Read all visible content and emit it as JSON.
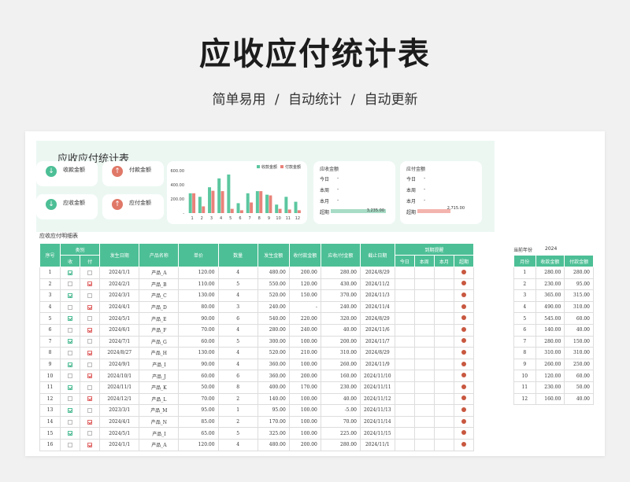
{
  "hero": {
    "title": "应收应付统计表",
    "subtitle": "简单易用  /  自动统计  /  自动更新"
  },
  "dashboard": {
    "title": "应收应付统计表",
    "kpis": [
      {
        "label": "收款金额",
        "icon": "down-arrow-icon",
        "color": "#4dbf96"
      },
      {
        "label": "付款金额",
        "icon": "up-arrow-icon",
        "color": "#e07868"
      },
      {
        "label": "应收金额",
        "icon": "down-arrow-icon",
        "color": "#4dbf96"
      },
      {
        "label": "应付金额",
        "icon": "up-arrow-icon",
        "color": "#e07868"
      }
    ],
    "summaries": [
      {
        "title": "应收金额",
        "rows": [
          {
            "label": "今日",
            "value": "-"
          },
          {
            "label": "本周",
            "value": "-"
          },
          {
            "label": "本月",
            "value": "-"
          },
          {
            "label": "超期",
            "value": "3,235.00"
          }
        ],
        "bar_color": "#a8dcc6",
        "bar_fill": 1.0
      },
      {
        "title": "应付金额",
        "rows": [
          {
            "label": "今日",
            "value": "-"
          },
          {
            "label": "本周",
            "value": "-"
          },
          {
            "label": "本月",
            "value": "-"
          },
          {
            "label": "超期",
            "value": "2,715.00"
          }
        ],
        "bar_color": "#f4b4ae",
        "bar_fill": 0.6
      }
    ]
  },
  "chart_data": {
    "type": "bar",
    "categories": [
      "1",
      "2",
      "3",
      "4",
      "5",
      "6",
      "7",
      "8",
      "9",
      "10",
      "11",
      "12"
    ],
    "series": [
      {
        "name": "收款金额",
        "color": "#5cc7a0",
        "values": [
          280,
          230,
          365,
          490,
          545,
          140,
          280,
          310,
          260,
          120,
          230,
          160
        ]
      },
      {
        "name": "付款金额",
        "color": "#e9827a",
        "values": [
          280,
          95,
          315,
          310,
          60,
          40,
          150,
          310,
          250,
          60,
          50,
          40
        ]
      }
    ],
    "ylim": [
      0,
      600
    ],
    "yticks": [
      "-",
      "200.00",
      "400.00",
      "600.00"
    ],
    "legend_position": "top-right"
  },
  "detail": {
    "title": "应收应付明细表",
    "headers": {
      "seq": "序号",
      "type": "类别",
      "recv": "收",
      "pay": "付",
      "date": "发生日期",
      "product": "产品名称",
      "price": "单价",
      "qty": "数量",
      "amount": "发生金额",
      "paid": "收付款金额",
      "balance": "应收/付金额",
      "due": "截止日期",
      "remind": "到期提醒",
      "today": "今日",
      "week": "本周",
      "month": "本月",
      "overdue": "超期"
    },
    "rows": [
      {
        "seq": "1",
        "type": "r",
        "date": "2024/1/1",
        "product": "产品_A",
        "price": "120.00",
        "qty": "4",
        "amount": "480.00",
        "paid": "200.00",
        "balance": "280.00",
        "due": "2024/8/29"
      },
      {
        "seq": "2",
        "type": "p",
        "date": "2024/2/1",
        "product": "产品_B",
        "price": "110.00",
        "qty": "5",
        "amount": "550.00",
        "paid": "120.00",
        "balance": "430.00",
        "due": "2024/11/2"
      },
      {
        "seq": "3",
        "type": "r",
        "date": "2024/3/1",
        "product": "产品_C",
        "price": "130.00",
        "qty": "4",
        "amount": "520.00",
        "paid": "150.00",
        "balance": "370.00",
        "due": "2024/11/3"
      },
      {
        "seq": "4",
        "type": "p",
        "date": "2024/4/1",
        "product": "产品_D",
        "price": "80.00",
        "qty": "3",
        "amount": "240.00",
        "paid": "-",
        "balance": "240.00",
        "due": "2024/11/4"
      },
      {
        "seq": "5",
        "type": "r",
        "date": "2024/5/1",
        "product": "产品_E",
        "price": "90.00",
        "qty": "6",
        "amount": "540.00",
        "paid": "220.00",
        "balance": "320.00",
        "due": "2024/8/29"
      },
      {
        "seq": "6",
        "type": "p",
        "date": "2024/6/1",
        "product": "产品_F",
        "price": "70.00",
        "qty": "4",
        "amount": "280.00",
        "paid": "240.00",
        "balance": "40.00",
        "due": "2024/11/6"
      },
      {
        "seq": "7",
        "type": "r",
        "date": "2024/7/1",
        "product": "产品_G",
        "price": "60.00",
        "qty": "5",
        "amount": "300.00",
        "paid": "100.00",
        "balance": "200.00",
        "due": "2024/11/7"
      },
      {
        "seq": "8",
        "type": "p",
        "date": "2024/8/27",
        "product": "产品_H",
        "price": "130.00",
        "qty": "4",
        "amount": "520.00",
        "paid": "210.00",
        "balance": "310.00",
        "due": "2024/8/29"
      },
      {
        "seq": "9",
        "type": "r",
        "date": "2024/9/1",
        "product": "产品_I",
        "price": "90.00",
        "qty": "4",
        "amount": "360.00",
        "paid": "100.00",
        "balance": "260.00",
        "due": "2024/11/9"
      },
      {
        "seq": "10",
        "type": "p",
        "date": "2024/10/1",
        "product": "产品_J",
        "price": "60.00",
        "qty": "6",
        "amount": "360.00",
        "paid": "200.00",
        "balance": "160.00",
        "due": "2024/11/10"
      },
      {
        "seq": "11",
        "type": "r",
        "date": "2024/11/1",
        "product": "产品_K",
        "price": "50.00",
        "qty": "8",
        "amount": "400.00",
        "paid": "170.00",
        "balance": "230.00",
        "due": "2024/11/11"
      },
      {
        "seq": "12",
        "type": "p",
        "date": "2024/12/1",
        "product": "产品_L",
        "price": "70.00",
        "qty": "2",
        "amount": "140.00",
        "paid": "100.00",
        "balance": "40.00",
        "due": "2024/11/12"
      },
      {
        "seq": "13",
        "type": "r",
        "date": "2023/3/1",
        "product": "产品_M",
        "price": "95.00",
        "qty": "1",
        "amount": "95.00",
        "paid": "100.00",
        "balance": "-5.00",
        "due": "2024/11/13"
      },
      {
        "seq": "14",
        "type": "p",
        "date": "2024/4/1",
        "product": "产品_N",
        "price": "85.00",
        "qty": "2",
        "amount": "170.00",
        "paid": "100.00",
        "balance": "70.00",
        "due": "2024/11/14"
      },
      {
        "seq": "15",
        "type": "r",
        "date": "2024/5/1",
        "product": "产品_I",
        "price": "65.00",
        "qty": "5",
        "amount": "325.00",
        "paid": "100.00",
        "balance": "225.00",
        "due": "2024/11/15"
      },
      {
        "seq": "16",
        "type": "p",
        "date": "2024/1/1",
        "product": "产品_A",
        "price": "120.00",
        "qty": "4",
        "amount": "480.00",
        "paid": "200.00",
        "balance": "280.00",
        "due": "2024/11/1"
      }
    ]
  },
  "side": {
    "year_label": "当前年份",
    "year": "2024",
    "headers": {
      "month": "月份",
      "recv": "收款金额",
      "pay": "付款金额"
    },
    "rows": [
      {
        "month": "1",
        "recv": "280.00",
        "pay": "280.00"
      },
      {
        "month": "2",
        "recv": "230.00",
        "pay": "95.00"
      },
      {
        "month": "3",
        "recv": "365.00",
        "pay": "315.00"
      },
      {
        "month": "4",
        "recv": "490.00",
        "pay": "310.00"
      },
      {
        "month": "5",
        "recv": "545.00",
        "pay": "60.00"
      },
      {
        "month": "6",
        "recv": "140.00",
        "pay": "40.00"
      },
      {
        "month": "7",
        "recv": "280.00",
        "pay": "150.00"
      },
      {
        "month": "8",
        "recv": "310.00",
        "pay": "310.00"
      },
      {
        "month": "9",
        "recv": "260.00",
        "pay": "250.00"
      },
      {
        "month": "10",
        "recv": "120.00",
        "pay": "60.00"
      },
      {
        "month": "11",
        "recv": "230.00",
        "pay": "50.00"
      },
      {
        "month": "12",
        "recv": "160.00",
        "pay": "40.00"
      }
    ]
  }
}
